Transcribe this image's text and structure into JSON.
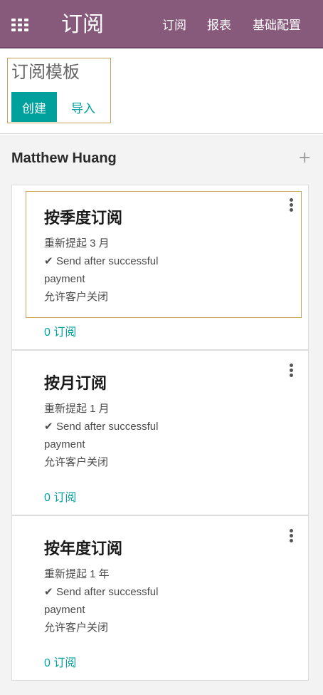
{
  "navbar": {
    "app_title": "订阅",
    "menu": [
      {
        "label": "订阅"
      },
      {
        "label": "报表"
      },
      {
        "label": "基础配置"
      }
    ],
    "apps_icon": "apps-grid-icon",
    "color": "#875a7b"
  },
  "control_panel": {
    "title": "订阅模板",
    "create_label": "创建",
    "import_label": "导入",
    "accent": "#00a09d"
  },
  "kanban": {
    "group_name": "Matthew Huang",
    "add_icon": "plus-icon",
    "cards": [
      {
        "title": "按季度订阅",
        "recurrence": "重新提起 3 月",
        "invoice_policy_line1": "Send after successful",
        "invoice_policy_line2": "payment",
        "closable": "允许客户关闭",
        "subscriptions_link": "0 订阅"
      },
      {
        "title": "按月订阅",
        "recurrence": "重新提起 1 月",
        "invoice_policy_line1": "Send after successful",
        "invoice_policy_line2": "payment",
        "closable": "允许客户关闭",
        "subscriptions_link": "0 订阅"
      },
      {
        "title": "按年度订阅",
        "recurrence": "重新提起 1 年",
        "invoice_policy_line1": "Send after successful",
        "invoice_policy_line2": "payment",
        "closable": "允许客户关闭",
        "subscriptions_link": "0 订阅"
      }
    ]
  }
}
